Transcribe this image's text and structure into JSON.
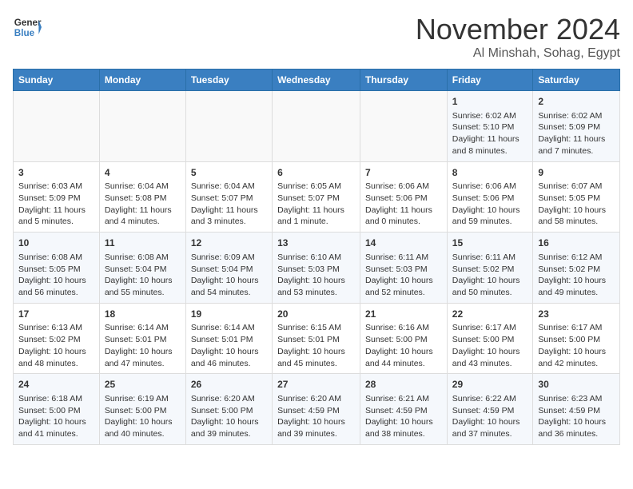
{
  "header": {
    "logo_line1": "General",
    "logo_line2": "Blue",
    "month": "November 2024",
    "location": "Al Minshah, Sohag, Egypt"
  },
  "weekdays": [
    "Sunday",
    "Monday",
    "Tuesday",
    "Wednesday",
    "Thursday",
    "Friday",
    "Saturday"
  ],
  "weeks": [
    [
      {
        "day": "",
        "content": ""
      },
      {
        "day": "",
        "content": ""
      },
      {
        "day": "",
        "content": ""
      },
      {
        "day": "",
        "content": ""
      },
      {
        "day": "",
        "content": ""
      },
      {
        "day": "1",
        "content": "Sunrise: 6:02 AM\nSunset: 5:10 PM\nDaylight: 11 hours and 8 minutes."
      },
      {
        "day": "2",
        "content": "Sunrise: 6:02 AM\nSunset: 5:09 PM\nDaylight: 11 hours and 7 minutes."
      }
    ],
    [
      {
        "day": "3",
        "content": "Sunrise: 6:03 AM\nSunset: 5:09 PM\nDaylight: 11 hours and 5 minutes."
      },
      {
        "day": "4",
        "content": "Sunrise: 6:04 AM\nSunset: 5:08 PM\nDaylight: 11 hours and 4 minutes."
      },
      {
        "day": "5",
        "content": "Sunrise: 6:04 AM\nSunset: 5:07 PM\nDaylight: 11 hours and 3 minutes."
      },
      {
        "day": "6",
        "content": "Sunrise: 6:05 AM\nSunset: 5:07 PM\nDaylight: 11 hours and 1 minute."
      },
      {
        "day": "7",
        "content": "Sunrise: 6:06 AM\nSunset: 5:06 PM\nDaylight: 11 hours and 0 minutes."
      },
      {
        "day": "8",
        "content": "Sunrise: 6:06 AM\nSunset: 5:06 PM\nDaylight: 10 hours and 59 minutes."
      },
      {
        "day": "9",
        "content": "Sunrise: 6:07 AM\nSunset: 5:05 PM\nDaylight: 10 hours and 58 minutes."
      }
    ],
    [
      {
        "day": "10",
        "content": "Sunrise: 6:08 AM\nSunset: 5:05 PM\nDaylight: 10 hours and 56 minutes."
      },
      {
        "day": "11",
        "content": "Sunrise: 6:08 AM\nSunset: 5:04 PM\nDaylight: 10 hours and 55 minutes."
      },
      {
        "day": "12",
        "content": "Sunrise: 6:09 AM\nSunset: 5:04 PM\nDaylight: 10 hours and 54 minutes."
      },
      {
        "day": "13",
        "content": "Sunrise: 6:10 AM\nSunset: 5:03 PM\nDaylight: 10 hours and 53 minutes."
      },
      {
        "day": "14",
        "content": "Sunrise: 6:11 AM\nSunset: 5:03 PM\nDaylight: 10 hours and 52 minutes."
      },
      {
        "day": "15",
        "content": "Sunrise: 6:11 AM\nSunset: 5:02 PM\nDaylight: 10 hours and 50 minutes."
      },
      {
        "day": "16",
        "content": "Sunrise: 6:12 AM\nSunset: 5:02 PM\nDaylight: 10 hours and 49 minutes."
      }
    ],
    [
      {
        "day": "17",
        "content": "Sunrise: 6:13 AM\nSunset: 5:02 PM\nDaylight: 10 hours and 48 minutes."
      },
      {
        "day": "18",
        "content": "Sunrise: 6:14 AM\nSunset: 5:01 PM\nDaylight: 10 hours and 47 minutes."
      },
      {
        "day": "19",
        "content": "Sunrise: 6:14 AM\nSunset: 5:01 PM\nDaylight: 10 hours and 46 minutes."
      },
      {
        "day": "20",
        "content": "Sunrise: 6:15 AM\nSunset: 5:01 PM\nDaylight: 10 hours and 45 minutes."
      },
      {
        "day": "21",
        "content": "Sunrise: 6:16 AM\nSunset: 5:00 PM\nDaylight: 10 hours and 44 minutes."
      },
      {
        "day": "22",
        "content": "Sunrise: 6:17 AM\nSunset: 5:00 PM\nDaylight: 10 hours and 43 minutes."
      },
      {
        "day": "23",
        "content": "Sunrise: 6:17 AM\nSunset: 5:00 PM\nDaylight: 10 hours and 42 minutes."
      }
    ],
    [
      {
        "day": "24",
        "content": "Sunrise: 6:18 AM\nSunset: 5:00 PM\nDaylight: 10 hours and 41 minutes."
      },
      {
        "day": "25",
        "content": "Sunrise: 6:19 AM\nSunset: 5:00 PM\nDaylight: 10 hours and 40 minutes."
      },
      {
        "day": "26",
        "content": "Sunrise: 6:20 AM\nSunset: 5:00 PM\nDaylight: 10 hours and 39 minutes."
      },
      {
        "day": "27",
        "content": "Sunrise: 6:20 AM\nSunset: 4:59 PM\nDaylight: 10 hours and 39 minutes."
      },
      {
        "day": "28",
        "content": "Sunrise: 6:21 AM\nSunset: 4:59 PM\nDaylight: 10 hours and 38 minutes."
      },
      {
        "day": "29",
        "content": "Sunrise: 6:22 AM\nSunset: 4:59 PM\nDaylight: 10 hours and 37 minutes."
      },
      {
        "day": "30",
        "content": "Sunrise: 6:23 AM\nSunset: 4:59 PM\nDaylight: 10 hours and 36 minutes."
      }
    ]
  ]
}
